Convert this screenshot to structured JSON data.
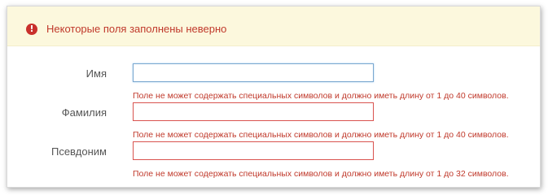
{
  "alert": {
    "icon": "exclamation-circle-icon",
    "message": "Некоторые поля заполнены неверно",
    "color": "#c0392b",
    "background": "#fcf8dd"
  },
  "fields": [
    {
      "label": "Имя",
      "value": "",
      "error": "Поле не может содержать специальных символов и должно иметь длину от 1 до 40 символов."
    },
    {
      "label": "Фамилия",
      "value": "",
      "error": "Поле не может содержать специальных символов и должно иметь длину от 1 до 40 символов."
    },
    {
      "label": "Псевдоним",
      "value": "",
      "error": "Поле не может содержать специальных символов и должно иметь длину от 1 до 32 символов."
    }
  ]
}
